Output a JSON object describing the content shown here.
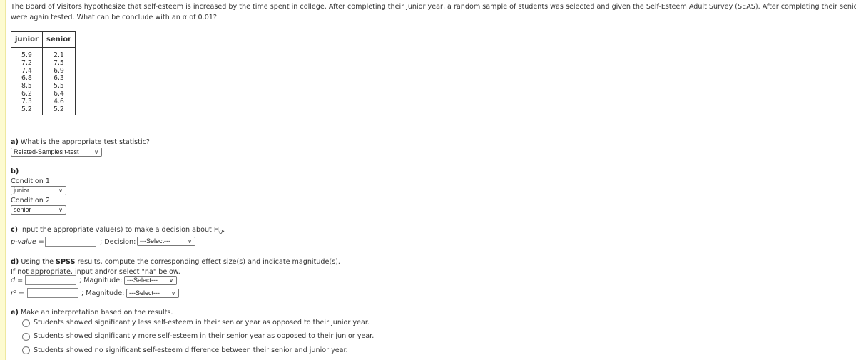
{
  "question": {
    "line1": "The Board of Visitors hypothesize that self-esteem is increased by the time spent in college.  After completing their junior year, a random sample of students was selected and given the Self-Esteem Adult Survey (SEAS).  After completing their senior year they",
    "line2": "were again tested.  What can be conclude with an α of 0.01?"
  },
  "table": {
    "headers": [
      "junior",
      "senior"
    ],
    "junior": [
      "5.9",
      "7.2",
      "7.4",
      "6.8",
      "8.5",
      "6.2",
      "7.3",
      "5.2"
    ],
    "senior": [
      "2.1",
      "7.5",
      "6.9",
      "6.3",
      "5.5",
      "6.4",
      "4.6",
      "5.2"
    ]
  },
  "a": {
    "label": "a)",
    "text": "What is the appropriate test statistic?",
    "select": "Related-Samples t-test"
  },
  "b": {
    "label": "b)",
    "cond1": "Condition 1:",
    "cond1_select": "junior",
    "cond2": "Condition 2:",
    "cond2_select": "senior"
  },
  "c": {
    "label": "c)",
    "text": "Input the appropriate value(s) to make a decision about H",
    "sub": "0",
    "end": ".",
    "pvalue": "p-value =",
    "decision": "; Decision:",
    "decision_select": "---Select---"
  },
  "d": {
    "label": "d)",
    "text1": "Using the",
    "spss": "SPSS",
    "text2": "results, compute the corresponding effect size(s) and indicate magnitude(s).",
    "line2": "If not appropriate, input and/or select \"na\" below.",
    "d_label": "d =",
    "r2_label": "r² =",
    "magnitude": "; Magnitude:",
    "select": "---Select---"
  },
  "e": {
    "label": "e)",
    "text": "Make an interpretation based on the results.",
    "options": [
      "Students showed significantly less self-esteem in their senior year as opposed to their junior year.",
      "Students showed significantly more self-esteem in their senior year as opposed to their junior year.",
      "Students showed no significant self-esteem difference between their senior and junior year."
    ]
  }
}
